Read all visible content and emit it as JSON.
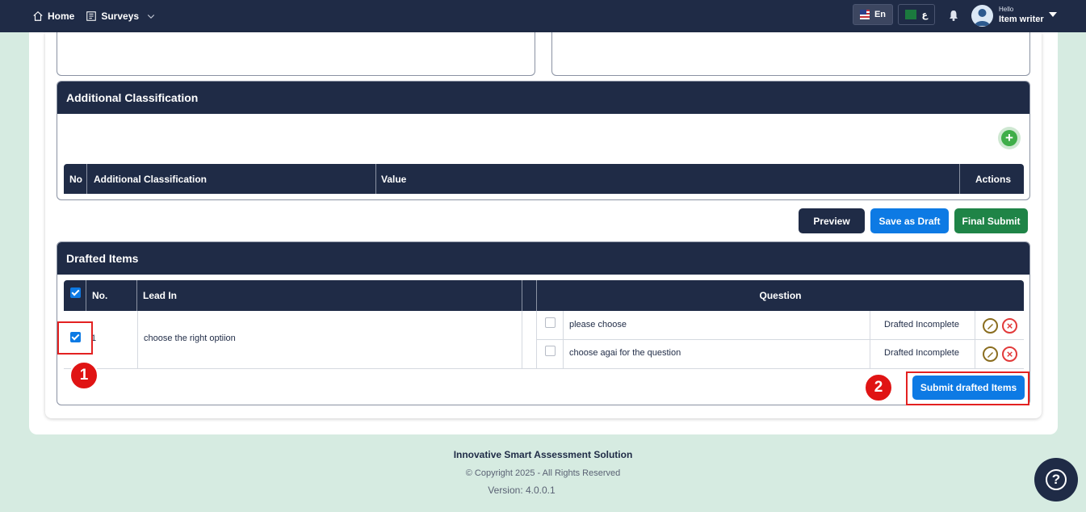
{
  "nav": {
    "home": "Home",
    "surveys": "Surveys"
  },
  "lang": {
    "en": "En",
    "ar": "ع"
  },
  "user": {
    "hello": "Hello",
    "name": "Item writer"
  },
  "additional_classification": {
    "title": "Additional Classification",
    "columns": [
      "No",
      "Additional Classification",
      "Value",
      "Actions"
    ]
  },
  "actions": {
    "preview": "Preview",
    "save_draft": "Save as Draft",
    "final_submit": "Final Submit"
  },
  "drafted": {
    "title": "Drafted Items",
    "columns": {
      "no": "No.",
      "lead_in": "Lead In",
      "question": "Question"
    },
    "row": {
      "no": "1",
      "lead_in": "choose the right optiion",
      "questions": [
        {
          "text": "please choose",
          "status": "Drafted Incomplete"
        },
        {
          "text": "choose agai  for the question",
          "status": "Drafted Incomplete"
        }
      ]
    },
    "submit_label": "Submit drafted Items"
  },
  "steps": [
    "1",
    "2"
  ],
  "footer": {
    "title": "Innovative Smart Assessment Solution",
    "copyright": "© Copyright 2025 - All Rights Reserved",
    "version": "Version: 4.0.0.1"
  },
  "colors": {
    "navy": "#1f2b46",
    "primary": "#0d7ae4",
    "success": "#1f8447",
    "highlight": "#e32121"
  }
}
